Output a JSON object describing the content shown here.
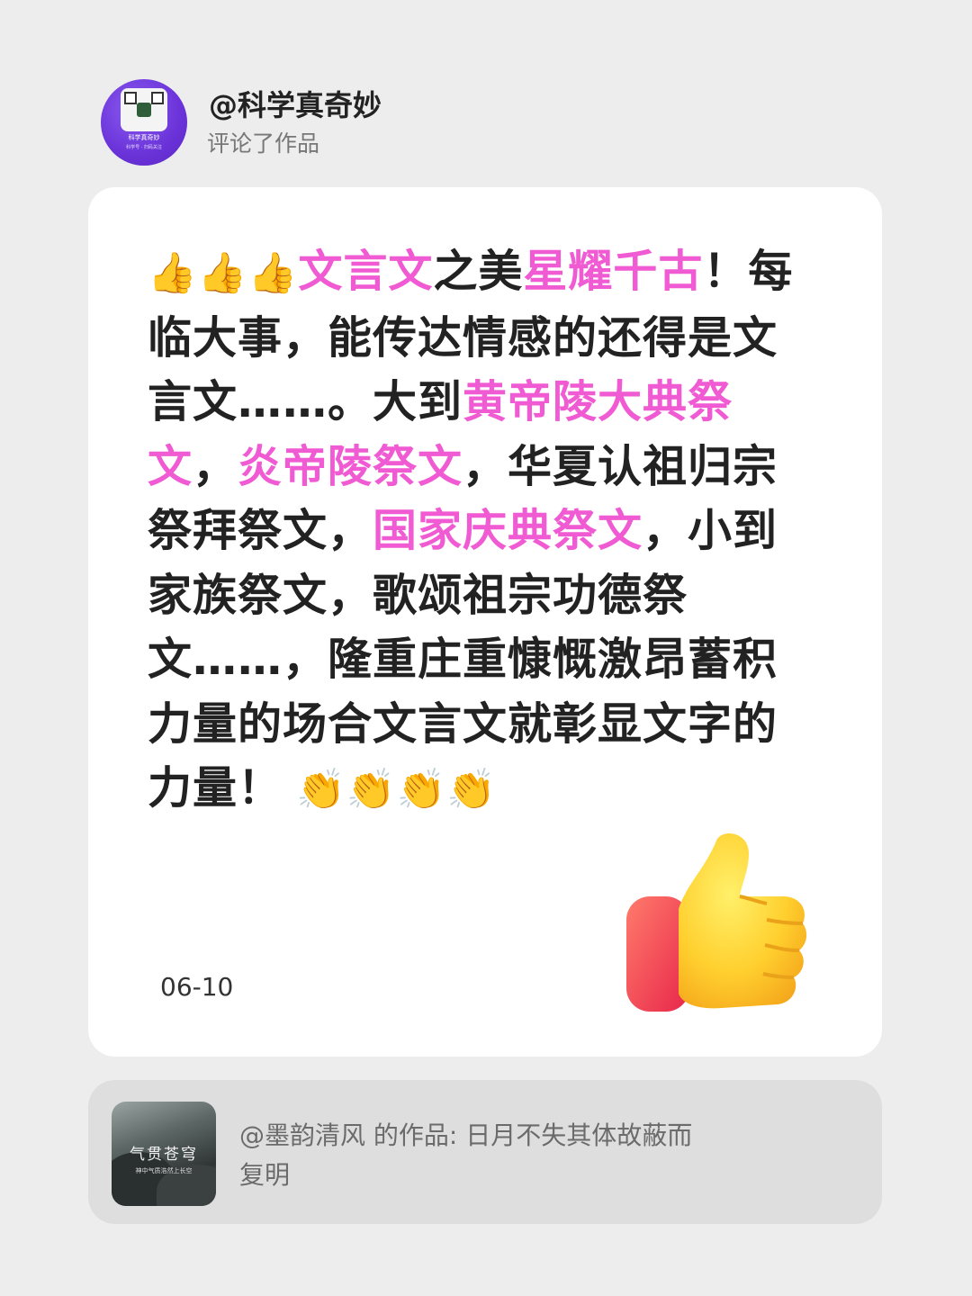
{
  "author": {
    "username": "@科学真奇妙",
    "action": "评论了作品",
    "avatar_caption": "科学真奇妙",
    "avatar_subcaption": "科学号 · 扫码关注"
  },
  "comment": {
    "segments": [
      {
        "text": "👍👍👍",
        "style": "emoji"
      },
      {
        "text": "文言文",
        "style": "highlight"
      },
      {
        "text": "之美",
        "style": "normal"
      },
      {
        "text": "星耀千古",
        "style": "highlight"
      },
      {
        "text": "！每临大事，能传达情感的还得是文言文……。大到",
        "style": "normal"
      },
      {
        "text": "黄帝陵大典祭文",
        "style": "highlight"
      },
      {
        "text": "，",
        "style": "normal"
      },
      {
        "text": "炎帝陵祭文",
        "style": "highlight"
      },
      {
        "text": "，华夏认祖归宗祭拜祭文，",
        "style": "normal"
      },
      {
        "text": "国家庆典祭文",
        "style": "highlight"
      },
      {
        "text": "，小到家族祭文，歌颂祖宗功德祭文……，隆重庄重慷慨激昂蓄积力量的场合文言文就彰显文字的力量！",
        "style": "normal"
      },
      {
        "text": " 👏👏👏👏",
        "style": "emoji"
      }
    ],
    "date": "06-10"
  },
  "reference": {
    "text": "@墨韵清风 的作品: 日月不失其体故蔽而复明",
    "thumbnail_title": "气贯苍穹",
    "thumbnail_subtitle": "神中气质浩然上长空"
  },
  "colors": {
    "highlight": "#f05ad2",
    "background": "#ededed",
    "card": "#ffffff",
    "reference_bg": "#dedede"
  },
  "icons": {
    "thumbs_up": "thumbs-up-icon",
    "clap": "clapping-hands-icon"
  }
}
